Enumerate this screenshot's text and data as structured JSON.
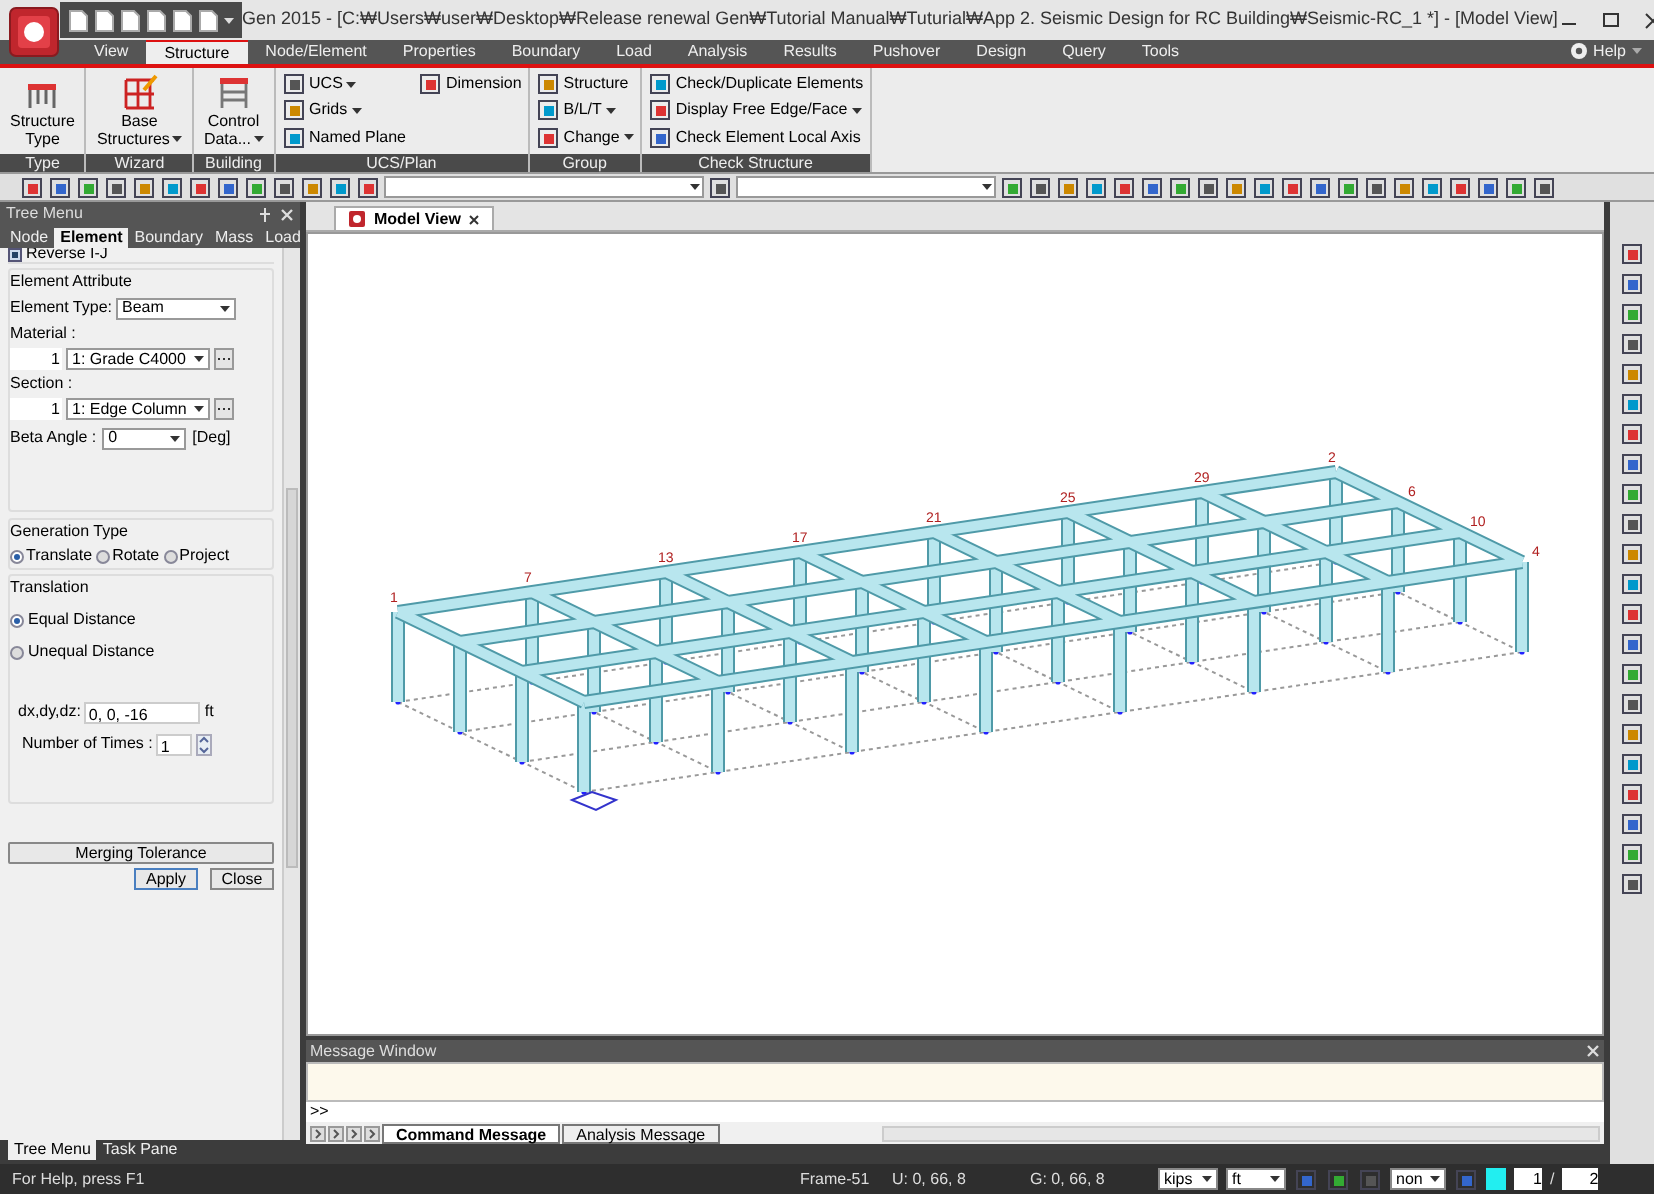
{
  "window": {
    "title": "Gen 2015 - [C:₩Users₩user₩Desktop₩Release renewal Gen₩Tutorial Manual₩Tuturial₩App 2. Seismic Design for RC Building₩Seismic-RC_1 *] - [Model View]"
  },
  "ribbon": {
    "tabs": [
      {
        "label": "View",
        "selected": false
      },
      {
        "label": "Structure",
        "selected": true
      },
      {
        "label": "Node/Element",
        "selected": false
      },
      {
        "label": "Properties",
        "selected": false
      },
      {
        "label": "Boundary",
        "selected": false
      },
      {
        "label": "Load",
        "selected": false
      },
      {
        "label": "Analysis",
        "selected": false
      },
      {
        "label": "Results",
        "selected": false
      },
      {
        "label": "Pushover",
        "selected": false
      },
      {
        "label": "Design",
        "selected": false
      },
      {
        "label": "Query",
        "selected": false
      },
      {
        "label": "Tools",
        "selected": false
      }
    ],
    "help": "Help",
    "groups": [
      {
        "label": "Type",
        "kind": "large",
        "items": [
          {
            "label": "Structure Type",
            "dropdown": false
          }
        ]
      },
      {
        "label": "Wizard",
        "kind": "large",
        "items": [
          {
            "label": "Base Structures",
            "dropdown": true
          }
        ]
      },
      {
        "label": "Building",
        "kind": "large",
        "items": [
          {
            "label": "Control Data...",
            "dropdown": true
          }
        ]
      },
      {
        "label": "UCS/Plan",
        "kind": "small",
        "items": [
          {
            "label": "UCS",
            "dropdown": true
          },
          {
            "label": "Grids",
            "dropdown": true
          },
          {
            "label": "Named Plane",
            "dropdown": false
          },
          {
            "label": "Dimension",
            "dropdown": false
          }
        ]
      },
      {
        "label": "Group",
        "kind": "small",
        "items": [
          {
            "label": "Structure",
            "dropdown": false
          },
          {
            "label": "B/L/T",
            "dropdown": true
          },
          {
            "label": "Change",
            "dropdown": true
          }
        ]
      },
      {
        "label": "Check Structure",
        "kind": "small",
        "items": [
          {
            "label": "Check/Duplicate Elements",
            "dropdown": false
          },
          {
            "label": "Display Free Edge/Face",
            "dropdown": true
          },
          {
            "label": "Check Element Local Axis",
            "dropdown": false
          }
        ]
      }
    ]
  },
  "tree_menu": {
    "title": "Tree Menu",
    "tabs": [
      {
        "label": "Node",
        "selected": false
      },
      {
        "label": "Element",
        "selected": true
      },
      {
        "label": "Boundary",
        "selected": false
      },
      {
        "label": "Mass",
        "selected": false
      },
      {
        "label": "Load",
        "selected": false
      }
    ],
    "reverse": {
      "label": "Reverse I-J",
      "checked": true
    },
    "attribute_title": "Element Attribute",
    "element_type": {
      "label": "Element Type:",
      "value": "Beam"
    },
    "material": {
      "label": "Material :",
      "number": "1",
      "value": "1: Grade C4000"
    },
    "section": {
      "label": "Section :",
      "number": "1",
      "value": "1: Edge Column"
    },
    "beta_angle": {
      "label": "Beta Angle :",
      "value": "0",
      "unit": "[Deg]"
    },
    "generation_title": "Generation Type",
    "generation_types": [
      {
        "label": "Translate",
        "selected": true
      },
      {
        "label": "Rotate",
        "selected": false
      },
      {
        "label": "Project",
        "selected": false
      }
    ],
    "translation_title": "Translation",
    "distances": [
      {
        "label": "Equal Distance",
        "selected": true
      },
      {
        "label": "Unequal Distance",
        "selected": false
      }
    ],
    "offsets": {
      "label": "dx,dy,dz:",
      "value": "0, 0, -16",
      "unit": "ft"
    },
    "times": {
      "label": "Number of Times :",
      "value": "1"
    },
    "buttons": [
      "Merging Tolerance",
      "Apply",
      "Close"
    ],
    "bottom_tabs": [
      {
        "label": "Tree Menu",
        "selected": true
      },
      {
        "label": "Task Pane",
        "selected": false
      }
    ]
  },
  "document_tabs": [
    {
      "label": "Model View",
      "selected": true
    }
  ],
  "model_view": {
    "node_labels": [
      "1",
      "7",
      "13",
      "17",
      "21",
      "25",
      "29",
      "2"
    ],
    "corner_labels": [
      "6",
      "10",
      "4"
    ]
  },
  "message_window": {
    "title": "Message Window",
    "prompt": ">>",
    "tabs": [
      {
        "label": "Command Message",
        "selected": true
      },
      {
        "label": "Analysis Message",
        "selected": false
      }
    ]
  },
  "status_bar": {
    "help": "For Help, press F1",
    "element": "Frame-51",
    "u": "U: 0, 66, 8",
    "g": "G: 0, 66, 8",
    "force_unit": "kips",
    "length_unit": "ft",
    "snap": "non",
    "page": "1",
    "separator": "/",
    "pages": "2"
  }
}
